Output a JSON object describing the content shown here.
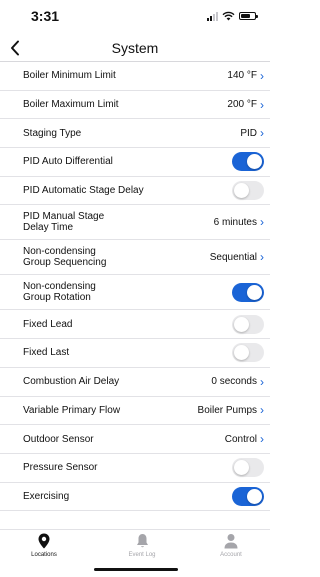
{
  "status_bar": {
    "time": "3:31",
    "signal_icon": "cellular-signal-icon",
    "wifi_icon": "wifi-icon",
    "battery_icon": "battery-icon"
  },
  "nav": {
    "title": "System",
    "back_icon": "chevron-left-icon"
  },
  "colors": {
    "accent": "#1a64d6",
    "toggle_off": "#e9e9eb",
    "divider": "#e2e2e6",
    "inactive_tab": "#a5a5aa"
  },
  "settings": [
    {
      "label": "Boiler Minimum Limit",
      "value": "140 °F",
      "type": "value"
    },
    {
      "label": "Boiler Maximum Limit",
      "value": "200 °F",
      "type": "value"
    },
    {
      "label": "Staging Type",
      "value": "PID",
      "type": "value"
    },
    {
      "label": "PID Auto Differential",
      "on": true,
      "type": "toggle"
    },
    {
      "label": "PID Automatic Stage Delay",
      "on": false,
      "type": "toggle"
    },
    {
      "label": "PID Manual Stage Delay Time",
      "value": "6 minutes",
      "type": "value"
    },
    {
      "label": "Non-condensing Group Sequencing",
      "value": "Sequential",
      "type": "value"
    },
    {
      "label": "Non-condensing Group Rotation",
      "on": true,
      "type": "toggle"
    },
    {
      "label": "Fixed Lead",
      "on": false,
      "type": "toggle"
    },
    {
      "label": "Fixed Last",
      "on": false,
      "type": "toggle"
    },
    {
      "label": "Combustion Air Delay",
      "value": "0 seconds",
      "type": "value"
    },
    {
      "label": "Variable Primary Flow",
      "value": "Boiler Pumps",
      "type": "value"
    },
    {
      "label": "Outdoor Sensor",
      "value": "Control",
      "type": "value"
    },
    {
      "label": "Pressure Sensor",
      "on": false,
      "type": "toggle"
    },
    {
      "label": "Exercising",
      "on": true,
      "type": "toggle"
    }
  ],
  "chevron": "›",
  "tabs": [
    {
      "label": "Locations",
      "icon": "location-pin-icon",
      "active": true
    },
    {
      "label": "Event Log",
      "icon": "bell-icon",
      "active": false
    },
    {
      "label": "Account",
      "icon": "person-icon",
      "active": false
    }
  ]
}
